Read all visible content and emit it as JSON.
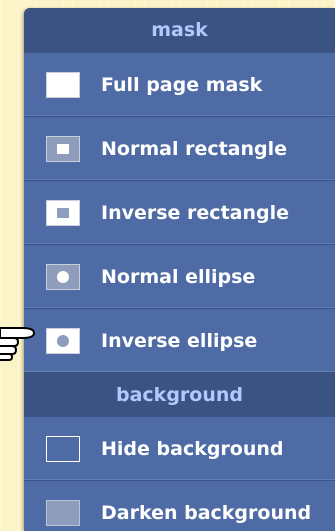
{
  "menu": {
    "mask_section": {
      "title": "mask",
      "items": [
        {
          "label": "Full page mask",
          "icon": "full-page-mask-icon"
        },
        {
          "label": "Normal rectangle",
          "icon": "normal-rectangle-icon"
        },
        {
          "label": "Inverse rectangle",
          "icon": "inverse-rectangle-icon"
        },
        {
          "label": "Normal ellipse",
          "icon": "normal-ellipse-icon"
        },
        {
          "label": "Inverse ellipse",
          "icon": "inverse-ellipse-icon"
        }
      ]
    },
    "background_section": {
      "title": "background",
      "items": [
        {
          "label": "Hide background",
          "icon": "hide-background-icon"
        },
        {
          "label": "Darken background",
          "icon": "darken-background-icon"
        }
      ]
    }
  },
  "cursor": {
    "icon": "pointing-hand-icon",
    "hover_item": "Inverse ellipse"
  },
  "colors": {
    "page_background": "#fcf3c6",
    "menu_background": "#4e6ba6",
    "header_background": "#3a5382",
    "header_text": "#b3c8ff",
    "item_text": "#ffffff"
  }
}
